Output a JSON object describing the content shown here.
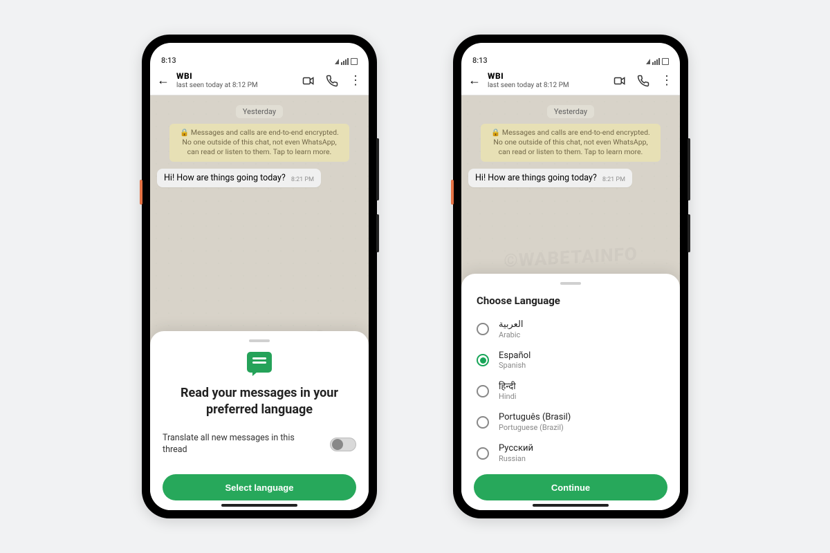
{
  "status": {
    "time": "8:13"
  },
  "header": {
    "brand": "WBI",
    "last_seen": "last seen today at 8:12 PM"
  },
  "chat": {
    "date_chip": "Yesterday",
    "encryption_notice": "🔒 Messages and calls are end-to-end encrypted. No one outside of this chat, not even WhatsApp, can read or listen to them. Tap to learn more.",
    "message_text": "Hi! How are things going today?",
    "message_time": "8:21 PM"
  },
  "sheet_translate": {
    "title": "Read your messages in your preferred language",
    "toggle_label": "Translate all new messages in this thread",
    "button_label": "Select language"
  },
  "sheet_language": {
    "title": "Choose Language",
    "button_label": "Continue",
    "options": [
      {
        "native": "العربية",
        "english": "Arabic",
        "selected": false
      },
      {
        "native": "Español",
        "english": "Spanish",
        "selected": true
      },
      {
        "native": "हिन्दी",
        "english": "Hindi",
        "selected": false
      },
      {
        "native": "Português (Brasil)",
        "english": "Portuguese (Brazil)",
        "selected": false
      },
      {
        "native": "Русский",
        "english": "Russian",
        "selected": false
      }
    ]
  },
  "watermark": "©WABETAINFO"
}
